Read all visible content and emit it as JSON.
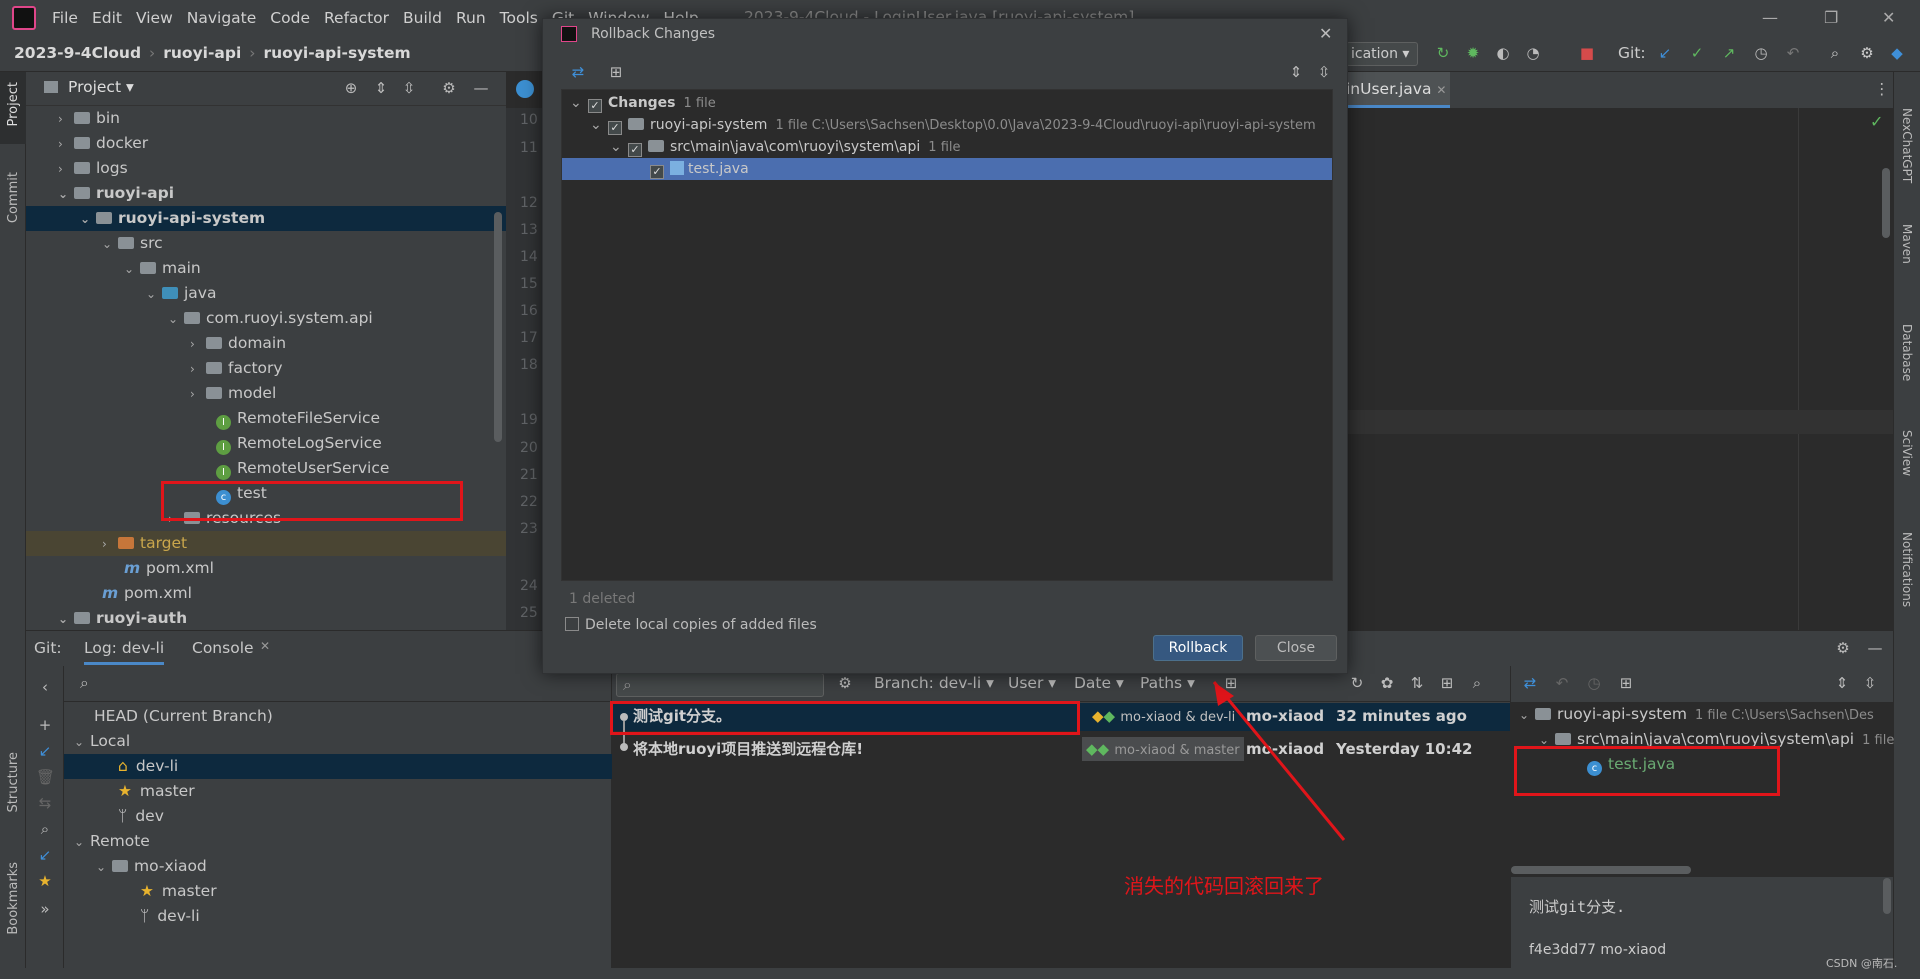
{
  "menubar": {
    "items": [
      "File",
      "Edit",
      "View",
      "Navigate",
      "Code",
      "Refactor",
      "Build",
      "Run",
      "Tools",
      "Git",
      "Window",
      "Help"
    ],
    "window_title": "2023-9-4Cloud - LoginUser.java [ruoyi-api-system]",
    "run_config": "ication",
    "git_label": "Git:"
  },
  "breadcrumb": [
    "2023-9-4Cloud",
    "ruoyi-api",
    "ruoyi-api-system"
  ],
  "project_panel": {
    "title": "Project",
    "rows": [
      {
        "label": "bin"
      },
      {
        "label": "docker"
      },
      {
        "label": "logs"
      },
      {
        "label": "ruoyi-api"
      },
      {
        "label": "ruoyi-api-system"
      },
      {
        "label": "src"
      },
      {
        "label": "main"
      },
      {
        "label": "java"
      },
      {
        "label": "com.ruoyi.system.api"
      },
      {
        "label": "domain"
      },
      {
        "label": "factory"
      },
      {
        "label": "model"
      },
      {
        "label": "RemoteFileService"
      },
      {
        "label": "RemoteLogService"
      },
      {
        "label": "RemoteUserService"
      },
      {
        "label": "test"
      },
      {
        "label": "resources"
      },
      {
        "label": "target"
      },
      {
        "label": "pom.xml"
      },
      {
        "label": "pom.xml"
      },
      {
        "label": "ruoyi-auth"
      }
    ]
  },
  "left_toolwindows": [
    "Project",
    "Commit",
    "Structure",
    "Bookmarks"
  ],
  "right_toolwindows": [
    "NexChatGPT",
    "Maven",
    "Database",
    "SciView",
    "Notifications"
  ],
  "editor": {
    "tab_label": "inUser.java",
    "line_numbers": [
      "10",
      "11",
      "12",
      "13",
      "14",
      "15",
      "16",
      "17",
      "18",
      "19",
      "20",
      "21",
      "22",
      "23",
      "24",
      "25"
    ]
  },
  "git_panel": {
    "tabs": [
      "Git:",
      "Log: dev-li",
      "Console"
    ],
    "branches": {
      "head": "HEAD (Current Branch)",
      "local_label": "Local",
      "local": [
        "dev-li",
        "master",
        "dev"
      ],
      "remote_label": "Remote",
      "remote_name": "mo-xiaod",
      "remote_branches": [
        "master",
        "dev-li"
      ]
    },
    "filters": {
      "branch": "Branch: dev-li",
      "user": "User",
      "date": "Date",
      "paths": "Paths"
    },
    "commits": [
      {
        "message": "测试git分支。",
        "refs": "mo-xiaod & dev-li",
        "author": "mo-xiaod",
        "time": "32 minutes ago"
      },
      {
        "message": "将本地ruoyi项目推送到远程仓库!",
        "refs": "mo-xiaod & master",
        "author": "mo-xiaod",
        "time": "Yesterday 10:42"
      }
    ],
    "details": {
      "module": "ruoyi-api-system",
      "module_info": "1 file  C:\\Users\\Sachsen\\Des",
      "path": "src\\main\\java\\com\\ruoyi\\system\\api",
      "path_info": "1 file",
      "file": "test.java",
      "commit_message": "测试git分支.",
      "hash_author": "f4e3dd77 mo-xiaod"
    }
  },
  "annotation": "消失的代码回滚回来了",
  "watermark": "CSDN @南石.",
  "dialog": {
    "title": "Rollback Changes",
    "tree": {
      "changes_label": "Changes",
      "changes_count": "1 file",
      "module": "ruoyi-api-system",
      "module_info": "1 file  C:\\Users\\Sachsen\\Desktop\\0.0\\Java\\2023-9-4Cloud\\ruoyi-api\\ruoyi-api-system",
      "path": "src\\main\\java\\com\\ruoyi\\system\\api",
      "path_info": "1 file",
      "file": "test.java"
    },
    "summary": "1 deleted",
    "delete_copies": "Delete local copies of added files",
    "rollback_label": "Rollback",
    "close_label": "Close"
  }
}
